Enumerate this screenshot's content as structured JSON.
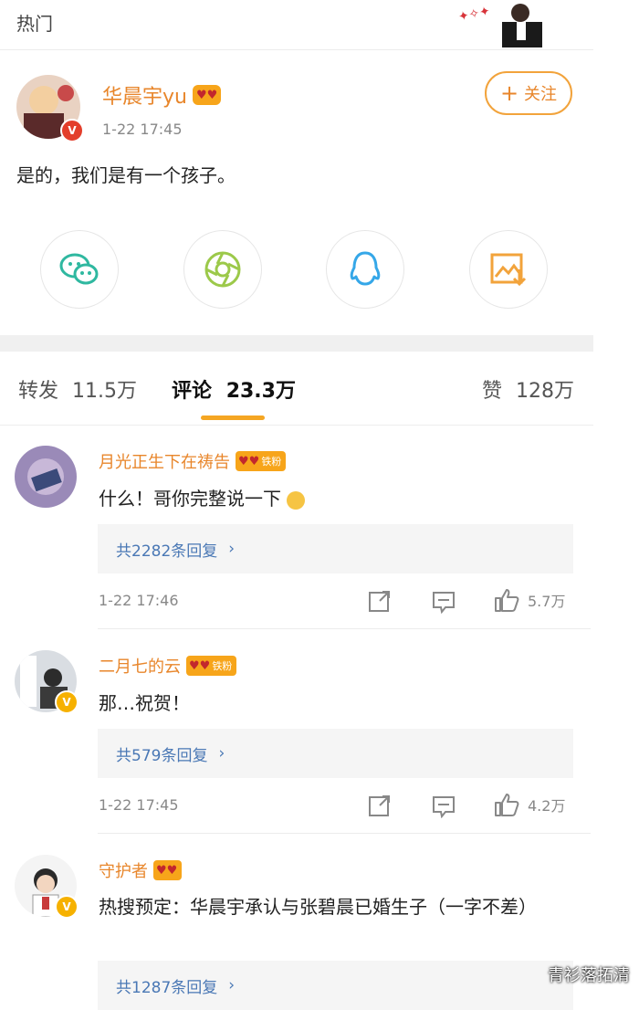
{
  "top": {
    "label": "热门"
  },
  "post": {
    "author": "华晨宇yu",
    "badge_icon": "heart-badge",
    "time": "1-22 17:45",
    "follow_label": "关注",
    "text": "是的，我们是有一个孩子。",
    "share_icons": [
      "wechat-icon",
      "moments-icon",
      "qq-icon",
      "save-image-icon"
    ]
  },
  "tabs": [
    {
      "label": "转发",
      "count": "11.5万"
    },
    {
      "label": "评论",
      "count": "23.3万"
    },
    {
      "label": "赞",
      "count": "128万"
    }
  ],
  "comments": [
    {
      "name": "月光正生下在祷告",
      "badge": "铁粉",
      "text": "什么！哥你完整说一下",
      "replies": "共2282条回复",
      "time": "1-22 17:46",
      "likes": "5.7万"
    },
    {
      "name": "二月七的云",
      "badge": "铁粉",
      "text": "那…祝贺！",
      "replies": "共579条回复",
      "time": "1-22 17:45",
      "likes": "4.2万"
    },
    {
      "name": "守护者",
      "badge": "",
      "text": "热搜预定：华晨宇承认与张碧晨已婚生子（一字不差）",
      "replies": "共1287条回复"
    }
  ],
  "watermark": "青衫落拓清",
  "colors": {
    "accent": "#e8862b",
    "link": "#4a78b5",
    "tab_underline": "#f5a623"
  }
}
